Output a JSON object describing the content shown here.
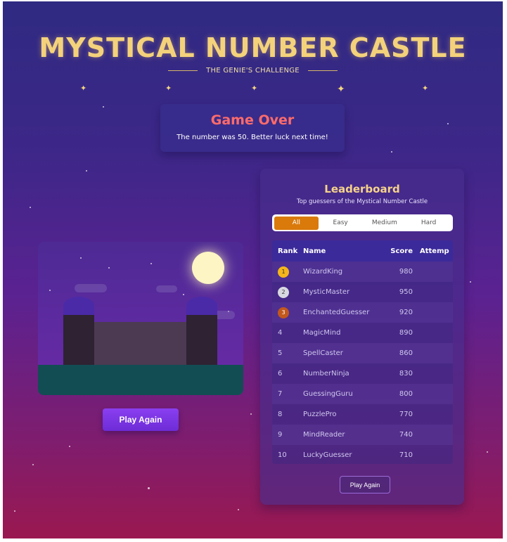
{
  "header": {
    "title": "MYSTICAL NUMBER CASTLE",
    "subtitle": "THE GENIE'S CHALLENGE"
  },
  "status": {
    "heading": "Game Over",
    "message": "The number was 50. Better luck next time!"
  },
  "actions": {
    "play_again": "Play Again"
  },
  "leaderboard": {
    "title": "Leaderboard",
    "subtitle": "Top guessers of the Mystical Number Castle",
    "tabs": [
      "All",
      "Easy",
      "Medium",
      "Hard"
    ],
    "active_tab": "All",
    "columns": [
      "Rank",
      "Name",
      "Score",
      "Attemp"
    ],
    "rows": [
      {
        "rank": "1",
        "name": "WizardKing",
        "score": "980"
      },
      {
        "rank": "2",
        "name": "MysticMaster",
        "score": "950"
      },
      {
        "rank": "3",
        "name": "EnchantedGuesser",
        "score": "920"
      },
      {
        "rank": "4",
        "name": "MagicMind",
        "score": "890"
      },
      {
        "rank": "5",
        "name": "SpellCaster",
        "score": "860"
      },
      {
        "rank": "6",
        "name": "NumberNinja",
        "score": "830"
      },
      {
        "rank": "7",
        "name": "GuessingGuru",
        "score": "800"
      },
      {
        "rank": "8",
        "name": "PuzzlePro",
        "score": "770"
      },
      {
        "rank": "9",
        "name": "MindReader",
        "score": "740"
      },
      {
        "rank": "10",
        "name": "LuckyGuesser",
        "score": "710"
      }
    ],
    "button": "Play Again"
  },
  "colors": {
    "title": "#f3d27b",
    "game_over": "#ff6b6b",
    "active_tab": "#d97a0b",
    "gold": "#f4b61a",
    "silver": "#d8d8e0",
    "bronze": "#c2581c"
  }
}
